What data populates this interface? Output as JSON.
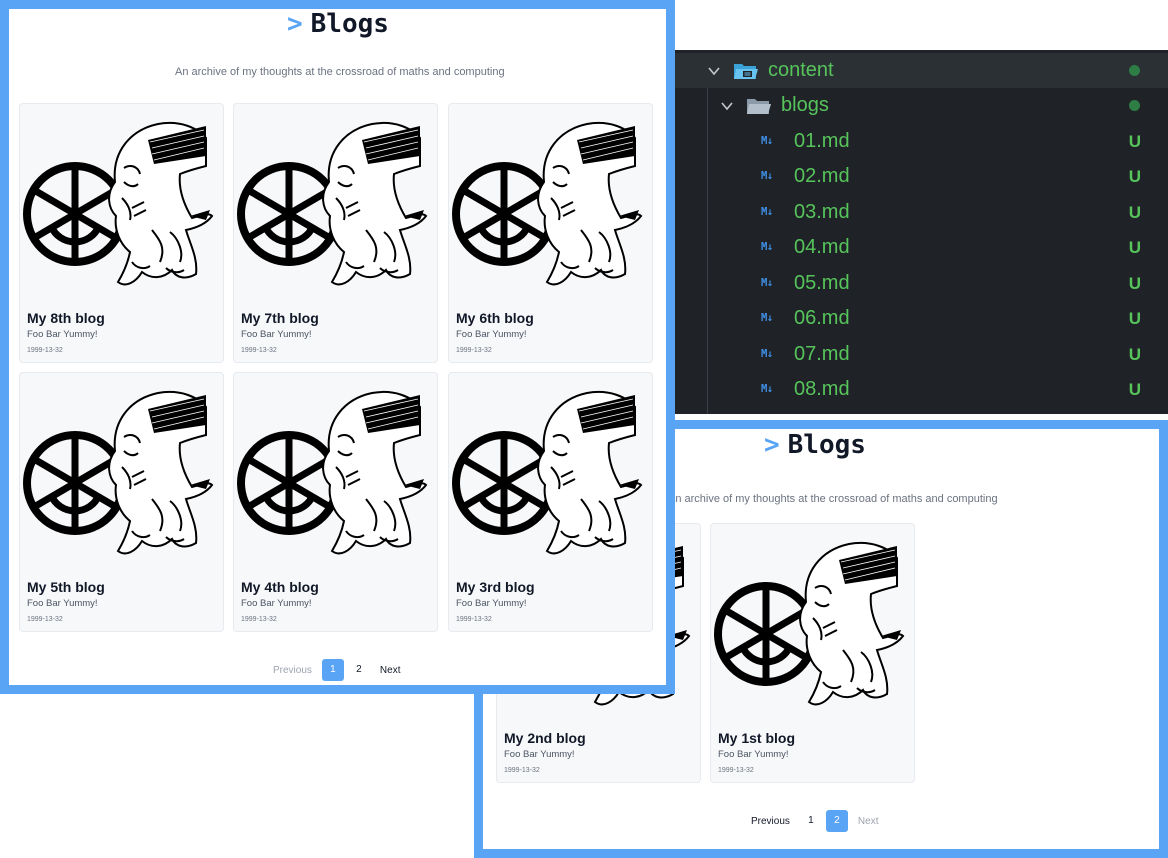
{
  "page1": {
    "caret": ">",
    "title": "Blogs",
    "subtitle": "An archive of my thoughts at the crossroad of maths and computing",
    "cards": [
      {
        "title": "My 8th blog",
        "desc": "Foo Bar Yummy!",
        "date": "1999-13-32"
      },
      {
        "title": "My 7th blog",
        "desc": "Foo Bar Yummy!",
        "date": "1999-13-32"
      },
      {
        "title": "My 6th blog",
        "desc": "Foo Bar Yummy!",
        "date": "1999-13-32"
      },
      {
        "title": "My 5th blog",
        "desc": "Foo Bar Yummy!",
        "date": "1999-13-32"
      },
      {
        "title": "My 4th blog",
        "desc": "Foo Bar Yummy!",
        "date": "1999-13-32"
      },
      {
        "title": "My 3rd blog",
        "desc": "Foo Bar Yummy!",
        "date": "1999-13-32"
      }
    ],
    "pagination": {
      "previous": "Previous",
      "pages": [
        "1",
        "2"
      ],
      "current": "1",
      "next": "Next"
    }
  },
  "page2": {
    "caret": ">",
    "title": "Blogs",
    "subtitle": "An archive of my thoughts at the crossroad of maths and computing",
    "cards": [
      {
        "title": "My 2nd blog",
        "desc": "Foo Bar Yummy!",
        "date": "1999-13-32"
      },
      {
        "title": "My 1st blog",
        "desc": "Foo Bar Yummy!",
        "date": "1999-13-32"
      }
    ],
    "pagination": {
      "previous": "Previous",
      "pages": [
        "1",
        "2"
      ],
      "current": "2",
      "next": "Next"
    }
  },
  "explorer": {
    "root_folder": {
      "name": "content",
      "icon": "folder-open-content-icon"
    },
    "sub_folder": {
      "name": "blogs",
      "icon": "folder-open-icon"
    },
    "files": [
      {
        "name": "01.md",
        "status": "U",
        "icon": "markdown-icon"
      },
      {
        "name": "02.md",
        "status": "U",
        "icon": "markdown-icon"
      },
      {
        "name": "03.md",
        "status": "U",
        "icon": "markdown-icon"
      },
      {
        "name": "04.md",
        "status": "U",
        "icon": "markdown-icon"
      },
      {
        "name": "05.md",
        "status": "U",
        "icon": "markdown-icon"
      },
      {
        "name": "06.md",
        "status": "U",
        "icon": "markdown-icon"
      },
      {
        "name": "07.md",
        "status": "U",
        "icon": "markdown-icon"
      },
      {
        "name": "08.md",
        "status": "U",
        "icon": "markdown-icon"
      }
    ],
    "md_icon_text": "M↓"
  },
  "colors": {
    "accent": "#5aa4f5",
    "editor_bg": "#1f2327",
    "git_untracked": "#56c45b",
    "md_icon": "#3f8fe6"
  }
}
